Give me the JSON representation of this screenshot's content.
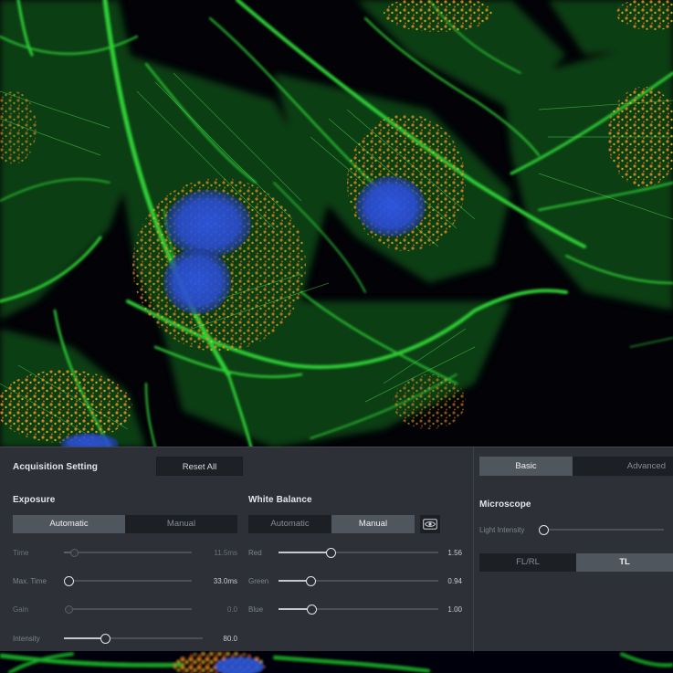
{
  "acquisition": {
    "title": "Acquisition Setting",
    "reset_label": "Reset All"
  },
  "view_tabs": {
    "basic": "Basic",
    "advanced": "Advanced",
    "active": "basic"
  },
  "exposure": {
    "title": "Exposure",
    "mode": {
      "automatic": "Automatic",
      "manual": "Manual",
      "active": "automatic"
    },
    "sliders": [
      {
        "label": "Time",
        "value": "11.5ms",
        "level": 0.08,
        "enabled": false
      },
      {
        "label": "Max. Time",
        "value": "33.0ms",
        "level": 0.0,
        "enabled": true
      },
      {
        "label": "Gain",
        "value": "0.0",
        "level": 0.0,
        "enabled": false
      },
      {
        "label": "Intensity",
        "value": "80.0",
        "level": 0.3,
        "enabled": true
      }
    ]
  },
  "white_balance": {
    "title": "White Balance",
    "mode": {
      "automatic": "Automatic",
      "manual": "Manual",
      "active": "manual"
    },
    "eye_icon": "eye-icon",
    "sliders": [
      {
        "label": "Red",
        "value": "1.56",
        "level": 0.33
      },
      {
        "label": "Green",
        "value": "0.94",
        "level": 0.2
      },
      {
        "label": "Blue",
        "value": "1.00",
        "level": 0.21
      }
    ]
  },
  "microscope": {
    "title": "Microscope",
    "light_intensity": {
      "label": "Light Intensity",
      "level": 0.0
    },
    "mode": {
      "fl_rl": "FL/RL",
      "tl": "TL",
      "active": "tl"
    }
  },
  "colors": {
    "actin": "#22c42b",
    "nucleus": "#2d5ce0",
    "mitochondria": "#f08a26",
    "panel": "#2d3137"
  }
}
